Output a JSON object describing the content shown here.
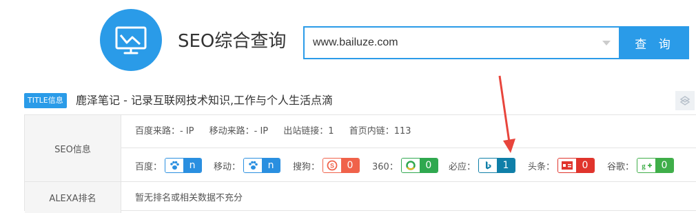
{
  "header": {
    "title": "SEO综合查询",
    "search_value": "www.bailuze.com",
    "search_button": "查 询"
  },
  "title_row": {
    "badge": "TITLE信息",
    "text": "鹿泽笔记 - 记录互联网技术知识,工作与个人生活点滴"
  },
  "seo": {
    "label": "SEO信息",
    "baidu_source": "百度来路：- IP",
    "mobile_source": "移动来路：- IP",
    "outlinks": "出站链接：1",
    "inlinks": "首页内链：113",
    "engines": [
      {
        "label": "百度：",
        "value": "n",
        "icon": "paw-icon",
        "color": "#2a8fe0"
      },
      {
        "label": "移动：",
        "value": "n",
        "icon": "paw-icon",
        "color": "#2a8fe0"
      },
      {
        "label": "搜狗：",
        "value": "0",
        "icon": "sogou-icon",
        "color": "#f0624a"
      },
      {
        "label": "360：",
        "value": "0",
        "icon": "360-icon",
        "color": "#2fa84f"
      },
      {
        "label": "必应：",
        "value": "1",
        "icon": "bing-icon",
        "color": "#0f7fa8"
      },
      {
        "label": "头条：",
        "value": "0",
        "icon": "toutiao-icon",
        "color": "#e0342c"
      },
      {
        "label": "谷歌：",
        "value": "0",
        "icon": "google-plus-icon",
        "color": "#3fae49"
      }
    ]
  },
  "alexa": {
    "label": "ALEXA排名",
    "text": "暂无排名或相关数据不充分"
  },
  "colors": {
    "accent": "#2a9be8",
    "arrow": "#e8453c"
  }
}
